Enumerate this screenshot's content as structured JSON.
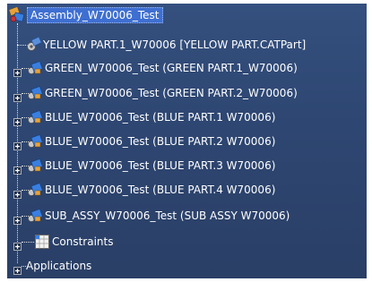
{
  "tree": {
    "root": {
      "label": "Assembly_W70006_Test",
      "icon": "assembly-icon"
    },
    "children": [
      {
        "label": "YELLOW PART.1_W70006 [YELLOW PART.CATPart]",
        "icon": "part-gear-icon",
        "expandable": false
      },
      {
        "label": "GREEN_W70006_Test (GREEN PART.1_W70006)",
        "icon": "product-icon",
        "expandable": true
      },
      {
        "label": "GREEN_W70006_Test (GREEN PART.2_W70006)",
        "icon": "product-icon",
        "expandable": true
      },
      {
        "label": "BLUE_W70006_Test (BLUE PART.1 W70006)",
        "icon": "product-icon",
        "expandable": true
      },
      {
        "label": "BLUE_W70006_Test (BLUE PART.2 W70006)",
        "icon": "product-icon",
        "expandable": true
      },
      {
        "label": "BLUE_W70006_Test (BLUE PART.3 W70006)",
        "icon": "product-icon",
        "expandable": true
      },
      {
        "label": "BLUE_W70006_Test (BLUE PART.4 W70006)",
        "icon": "product-icon",
        "expandable": true
      },
      {
        "label": "SUB_ASSY_W70006_Test (SUB ASSY W70006)",
        "icon": "product-icon",
        "expandable": true
      },
      {
        "label": "Constraints",
        "icon": "constraints-icon",
        "expandable": true
      },
      {
        "label": "Applications",
        "icon": "",
        "expandable": true
      }
    ]
  },
  "colors": {
    "background": "#2e4773",
    "selection": "#3e6fd1",
    "text": "#ffffff"
  }
}
